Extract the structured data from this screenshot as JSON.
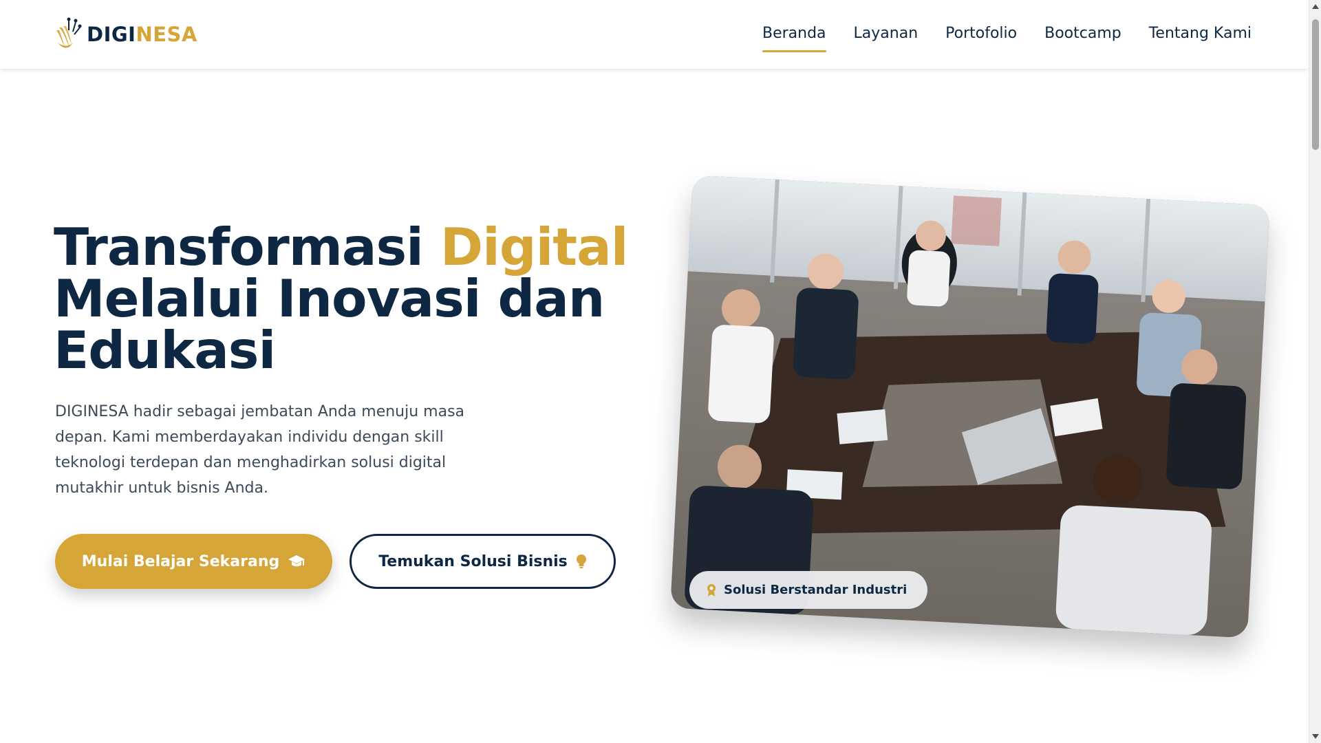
{
  "brand": {
    "name_dark": "DIGI",
    "name_gold": "NESA"
  },
  "nav": [
    {
      "label": "Beranda",
      "active": true
    },
    {
      "label": "Layanan",
      "active": false
    },
    {
      "label": "Portofolio",
      "active": false
    },
    {
      "label": "Bootcamp",
      "active": false
    },
    {
      "label": "Tentang Kami",
      "active": false
    }
  ],
  "hero": {
    "title_part1": "Transformasi ",
    "title_highlight": "Digital",
    "title_part2": "Melalui Inovasi dan Edukasi",
    "description": "DIGINESA hadir sebagai jembatan Anda menuju masa depan. Kami memberdayakan individu dengan skill teknologi terdepan dan menghadirkan solusi digital mutakhir untuk bisnis Anda.",
    "primary_button": "Mulai Belajar Sekarang",
    "secondary_button": "Temukan Solusi Bisnis"
  },
  "badge": {
    "label": "Solusi Berstandar Industri"
  },
  "icons": {
    "primary_button": "graduation-cap-icon",
    "secondary_button": "lightbulb-icon",
    "badge": "award-icon"
  },
  "colors": {
    "navy": "#0e2843",
    "gold": "#d5a637"
  }
}
